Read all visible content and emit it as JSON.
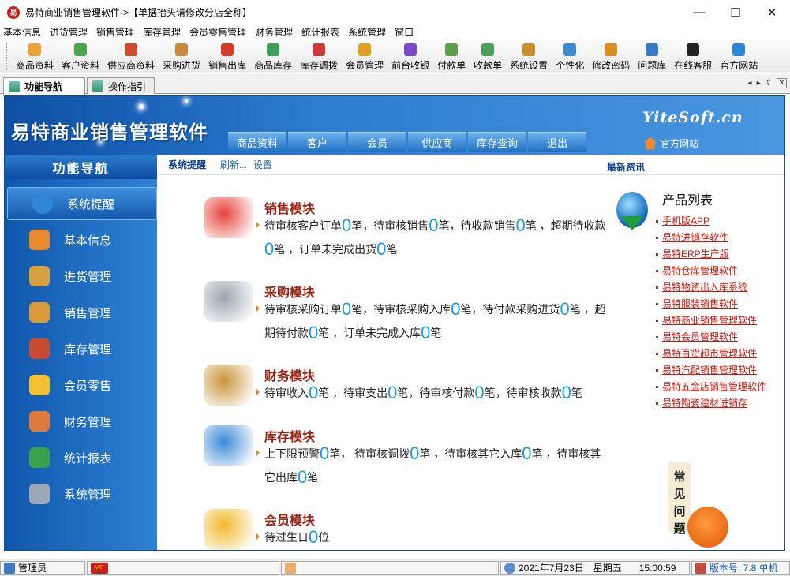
{
  "window": {
    "title": "易特商业销售管理软件->【单据抬头请修改分店全称】",
    "app_icon_char": "易"
  },
  "window_controls": {
    "minimize": "—",
    "maximize": "☐",
    "close": "✕"
  },
  "menu": [
    "基本信息",
    "进货管理",
    "销售管理",
    "库存管理",
    "会员零售管理",
    "财务管理",
    "统计报表",
    "系统管理",
    "窗口"
  ],
  "toolbar": [
    {
      "label": "商品资料",
      "color": "#f0a030"
    },
    {
      "label": "客户资料",
      "color": "#4aa84a"
    },
    {
      "label": "供应商资料",
      "color": "#d04b2c"
    },
    {
      "label": "采购进货",
      "color": "#c88a3c"
    },
    {
      "label": "销售出库",
      "color": "#d83a28"
    },
    {
      "label": "商品库存",
      "color": "#3aa05a"
    },
    {
      "label": "库存调拨",
      "color": "#cc3a3a"
    },
    {
      "label": "会员管理",
      "color": "#e0a020"
    },
    {
      "label": "前台收银",
      "color": "#7a4ac8"
    },
    {
      "label": "付款单",
      "color": "#5aa04a"
    },
    {
      "label": "收款单",
      "color": "#48a058"
    },
    {
      "label": "系统设置",
      "color": "#c89028"
    },
    {
      "label": "个性化",
      "color": "#3c8ad0"
    },
    {
      "label": "修改密码",
      "color": "#e08a20"
    },
    {
      "label": "问题库",
      "color": "#3c78c8"
    },
    {
      "label": "在线客服",
      "color": "#222222"
    },
    {
      "label": "官方网站",
      "color": "#2a88d8"
    }
  ],
  "tabs": [
    {
      "label": "功能导航",
      "active": true
    },
    {
      "label": "操作指引",
      "active": false
    }
  ],
  "tab_controls": {
    "prev": "◂",
    "next": "▸",
    "list": "⇕",
    "close": "✕"
  },
  "banner": {
    "title": "易特商业销售管理软件",
    "brand": "YiteSoft.cn",
    "official_site": "官方网站",
    "nav": [
      "商品资料",
      "客户",
      "会员",
      "供应商",
      "库存查询",
      "退出"
    ]
  },
  "sidebar": {
    "header": "功能导航",
    "items": [
      {
        "label": "系统提醒",
        "icon": "info-icon",
        "color": "#2f86d8",
        "active": true
      },
      {
        "label": "基本信息",
        "icon": "cubes-icon",
        "color": "#e88a2c"
      },
      {
        "label": "进货管理",
        "icon": "box-in-icon",
        "color": "#d7a040"
      },
      {
        "label": "销售管理",
        "icon": "box-out-icon",
        "color": "#d89a3a"
      },
      {
        "label": "库存管理",
        "icon": "warehouse-icon",
        "color": "#c84a30"
      },
      {
        "label": "会员零售",
        "icon": "members-icon",
        "color": "#f2c030"
      },
      {
        "label": "财务管理",
        "icon": "finance-icon",
        "color": "#e07a3a"
      },
      {
        "label": "统计报表",
        "icon": "chart-icon",
        "color": "#3aa04a"
      },
      {
        "label": "系统管理",
        "icon": "tools-icon",
        "color": "#9aa8b8"
      }
    ]
  },
  "content_header": {
    "reminder": "系统提醒",
    "refresh": "刷新...",
    "settings": "设置",
    "news": "最新资讯"
  },
  "modules": [
    {
      "title": "销售模块",
      "icon": "sale-car-icon",
      "icon_color": "#e8423a",
      "parts": [
        "待审核客户订单",
        "0",
        "笔，待审核销售",
        "0",
        "笔，待收款销售",
        "0",
        "笔 ，超期待收款",
        "0",
        "笔 ，订单未完成出货",
        "0",
        "笔"
      ]
    },
    {
      "title": "采购模块",
      "icon": "cart-icon",
      "icon_color": "#9aa4ae",
      "parts": [
        "待审核采购订单",
        "0",
        "笔，待审核采购入库",
        "0",
        "笔，待付款采购进货",
        "0",
        "笔 ，超期待付款",
        "0",
        "笔 ，订单未完成入库",
        "0",
        "笔"
      ]
    },
    {
      "title": "财务模块",
      "icon": "coins-icon",
      "icon_color": "#c9953a",
      "parts": [
        "待审收入",
        "0",
        "笔 ，待审支出",
        "0",
        "笔，待审核付款",
        "0",
        "笔，待审核收款",
        "0",
        "笔"
      ]
    },
    {
      "title": "库存模块",
      "icon": "cube-stack-icon",
      "icon_color": "#3a8ad8",
      "parts": [
        "上下限预警",
        "0",
        "笔， 待审核调拨",
        "0",
        "笔 ，待审核其它入库",
        "0",
        "笔 ，待审核其它出库",
        "0",
        "笔"
      ]
    },
    {
      "title": "会员模块",
      "icon": "chat-bubbles-icon",
      "icon_color": "#f2b92a",
      "parts": [
        "待过生日",
        "0",
        "位"
      ]
    }
  ],
  "product_list": {
    "title": "产品列表",
    "items": [
      "手机版APP",
      "易特进销存软件",
      "易特ERP生产版",
      "易特仓库管理软件",
      "易特物资出入库系统",
      "易特服装销售软件",
      "易特商业销售管理软件",
      "易特会员管理软件",
      "易特百货超市管理软件",
      "易特汽配销售管理软件",
      "易特五金店销售管理软件",
      "易特陶瓷建材进销存"
    ]
  },
  "faq": [
    "常",
    "见",
    "问",
    "题"
  ],
  "status": {
    "user": "管理员",
    "vip": "VIP",
    "date": "2021年7月23日",
    "weekday": "星期五",
    "time": "15:00:59",
    "version": "版本号: 7.8 单机"
  }
}
